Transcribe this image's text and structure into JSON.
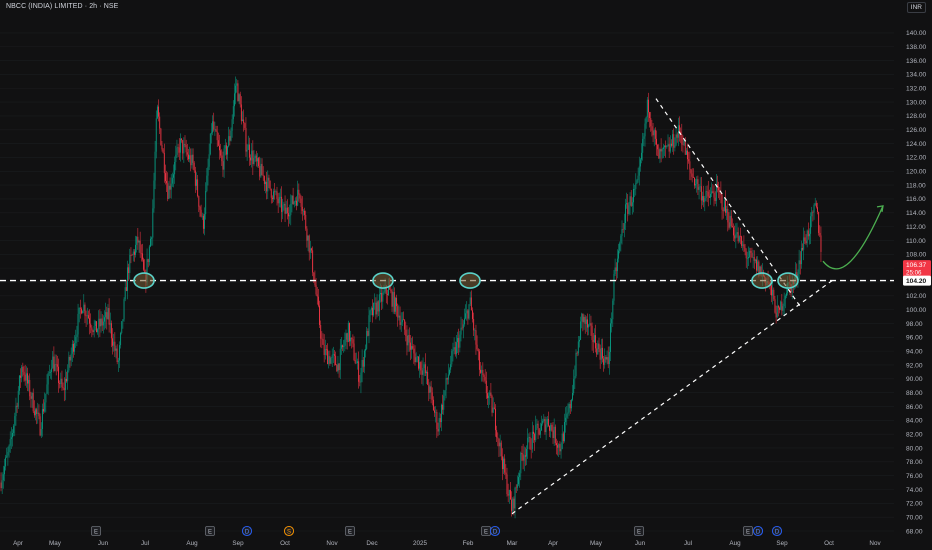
{
  "header": {
    "symbol_line": "NBCC (INDIA) LIMITED · 2h · NSE",
    "currency_label": "INR"
  },
  "colors": {
    "background": "#111112",
    "up": "#089981",
    "down": "#f23645",
    "level_line": "#ffffff",
    "arrow": "#4caf50",
    "circle": "#5ad1c8",
    "price_badge": "#f23645",
    "level_badge": "#ffffff"
  },
  "chart_data": {
    "type": "candlestick",
    "y_axis": {
      "min": 68,
      "max": 141,
      "tick_step": 2,
      "ticks": [
        "140.00",
        "138.00",
        "136.00",
        "134.00",
        "132.00",
        "130.00",
        "128.00",
        "126.00",
        "124.00",
        "122.00",
        "120.00",
        "118.00",
        "116.00",
        "114.00",
        "112.00",
        "110.00",
        "108.00",
        "106.00",
        "104.00",
        "102.00",
        "100.00",
        "98.00",
        "96.00",
        "94.00",
        "92.00",
        "90.00",
        "88.00",
        "86.00",
        "84.00",
        "82.00",
        "80.00",
        "78.00",
        "76.00",
        "74.00",
        "72.00",
        "70.00",
        "68.00"
      ]
    },
    "x_axis": {
      "labels": [
        "Apr",
        "May",
        "Jun",
        "Jul",
        "Aug",
        "Sep",
        "Oct",
        "Nov",
        "Dec",
        "2025",
        "Feb",
        "Mar",
        "Apr",
        "May",
        "Jun",
        "Jul",
        "Aug",
        "Sep",
        "Oct",
        "Nov"
      ]
    },
    "price_path": [
      {
        "t": 0,
        "p": 75
      },
      {
        "t": 10,
        "p": 80
      },
      {
        "t": 22,
        "p": 92
      },
      {
        "t": 40,
        "p": 83
      },
      {
        "t": 52,
        "p": 93
      },
      {
        "t": 63,
        "p": 88
      },
      {
        "t": 82,
        "p": 101
      },
      {
        "t": 95,
        "p": 97
      },
      {
        "t": 108,
        "p": 99
      },
      {
        "t": 118,
        "p": 92
      },
      {
        "t": 128,
        "p": 106
      },
      {
        "t": 138,
        "p": 110
      },
      {
        "t": 145,
        "p": 104
      },
      {
        "t": 152,
        "p": 112
      },
      {
        "t": 157,
        "p": 129
      },
      {
        "t": 168,
        "p": 117
      },
      {
        "t": 180,
        "p": 124
      },
      {
        "t": 193,
        "p": 121
      },
      {
        "t": 203,
        "p": 112
      },
      {
        "t": 212,
        "p": 127
      },
      {
        "t": 222,
        "p": 121
      },
      {
        "t": 230,
        "p": 125
      },
      {
        "t": 236,
        "p": 133
      },
      {
        "t": 246,
        "p": 124
      },
      {
        "t": 256,
        "p": 121
      },
      {
        "t": 268,
        "p": 118
      },
      {
        "t": 285,
        "p": 114
      },
      {
        "t": 300,
        "p": 117
      },
      {
        "t": 312,
        "p": 107
      },
      {
        "t": 323,
        "p": 94
      },
      {
        "t": 338,
        "p": 92
      },
      {
        "t": 348,
        "p": 97
      },
      {
        "t": 360,
        "p": 90
      },
      {
        "t": 370,
        "p": 99
      },
      {
        "t": 388,
        "p": 103
      },
      {
        "t": 400,
        "p": 99
      },
      {
        "t": 412,
        "p": 94
      },
      {
        "t": 425,
        "p": 91
      },
      {
        "t": 438,
        "p": 83
      },
      {
        "t": 450,
        "p": 92
      },
      {
        "t": 462,
        "p": 97
      },
      {
        "t": 470,
        "p": 101
      },
      {
        "t": 480,
        "p": 91
      },
      {
        "t": 494,
        "p": 85
      },
      {
        "t": 505,
        "p": 76
      },
      {
        "t": 512,
        "p": 71
      },
      {
        "t": 522,
        "p": 79
      },
      {
        "t": 535,
        "p": 82
      },
      {
        "t": 548,
        "p": 84
      },
      {
        "t": 560,
        "p": 80
      },
      {
        "t": 570,
        "p": 86
      },
      {
        "t": 582,
        "p": 99
      },
      {
        "t": 596,
        "p": 95
      },
      {
        "t": 608,
        "p": 92
      },
      {
        "t": 614,
        "p": 104
      },
      {
        "t": 625,
        "p": 114
      },
      {
        "t": 638,
        "p": 118
      },
      {
        "t": 648,
        "p": 130
      },
      {
        "t": 658,
        "p": 122
      },
      {
        "t": 668,
        "p": 123
      },
      {
        "t": 680,
        "p": 126
      },
      {
        "t": 690,
        "p": 120
      },
      {
        "t": 705,
        "p": 116
      },
      {
        "t": 718,
        "p": 117
      },
      {
        "t": 732,
        "p": 112
      },
      {
        "t": 746,
        "p": 108
      },
      {
        "t": 758,
        "p": 106
      },
      {
        "t": 768,
        "p": 104
      },
      {
        "t": 778,
        "p": 99
      },
      {
        "t": 786,
        "p": 103
      },
      {
        "t": 795,
        "p": 104
      },
      {
        "t": 802,
        "p": 109
      },
      {
        "t": 810,
        "p": 112
      },
      {
        "t": 816,
        "p": 115
      },
      {
        "t": 822,
        "p": 108
      }
    ],
    "last_price": {
      "value": "106.37",
      "countdown": "25:06"
    },
    "level_label": "104.20",
    "horizontal_level": 104.2,
    "trendlines": [
      {
        "from_t": 656,
        "from_p": 130.5,
        "to_t": 800,
        "to_p": 100.5
      },
      {
        "from_t": 512,
        "from_p": 70.5,
        "to_t": 835,
        "to_p": 104.5
      }
    ],
    "circle_markers": [
      {
        "t": 144,
        "p": 104.2
      },
      {
        "t": 383,
        "p": 104.2
      },
      {
        "t": 470,
        "p": 104.2
      },
      {
        "t": 762,
        "p": 104.2
      },
      {
        "t": 788,
        "p": 104.2
      }
    ],
    "projection_arrow": [
      {
        "t": 823,
        "p": 107
      },
      {
        "t": 840,
        "p": 104.8
      },
      {
        "t": 860,
        "p": 108
      },
      {
        "t": 883,
        "p": 115
      }
    ],
    "event_markers": [
      {
        "t": 96,
        "label": "E",
        "kind": "earnings"
      },
      {
        "t": 210,
        "label": "E",
        "kind": "earnings"
      },
      {
        "t": 247,
        "label": "D",
        "kind": "dividend"
      },
      {
        "t": 289,
        "label": "S",
        "kind": "split"
      },
      {
        "t": 350,
        "label": "E",
        "kind": "earnings"
      },
      {
        "t": 486,
        "label": "E",
        "kind": "earnings"
      },
      {
        "t": 495,
        "label": "D",
        "kind": "dividend"
      },
      {
        "t": 639,
        "label": "E",
        "kind": "earnings"
      },
      {
        "t": 748,
        "label": "E",
        "kind": "earnings"
      },
      {
        "t": 758,
        "label": "D",
        "kind": "dividend"
      },
      {
        "t": 777,
        "label": "D",
        "kind": "dividend"
      }
    ]
  }
}
